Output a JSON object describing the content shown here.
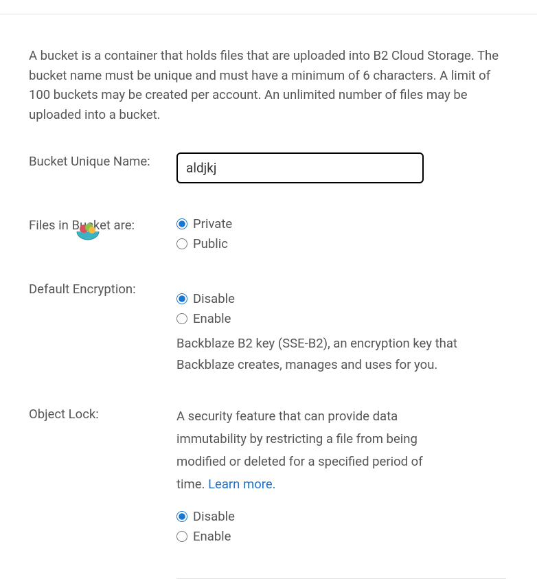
{
  "intro": "A bucket is a container that holds files that are uploaded into B2 Cloud Storage. The bucket name must be unique and must have a minimum of 6 characters. A limit of 100 buckets may be created per account. An unlimited number of files may be uploaded into a bucket.",
  "bucket_name": {
    "label": "Bucket Unique Name:",
    "value": "aldjkj"
  },
  "files_in_bucket": {
    "label": "Files in Bucket are:",
    "options": {
      "private": "Private",
      "public": "Public"
    },
    "selected": "private"
  },
  "default_encryption": {
    "label": "Default Encryption:",
    "options": {
      "disable": "Disable",
      "enable": "Enable"
    },
    "selected": "disable",
    "help": "Backblaze B2 key (SSE-B2), an encryption key that Backblaze creates, manages and uses for you."
  },
  "object_lock": {
    "label": "Object Lock:",
    "description": "A security feature that can provide data immutability by restricting a file from being modified or deleted for a specified period of time. ",
    "learn_more": "Learn more.",
    "options": {
      "disable": "Disable",
      "enable": "Enable"
    },
    "selected": "disable"
  }
}
